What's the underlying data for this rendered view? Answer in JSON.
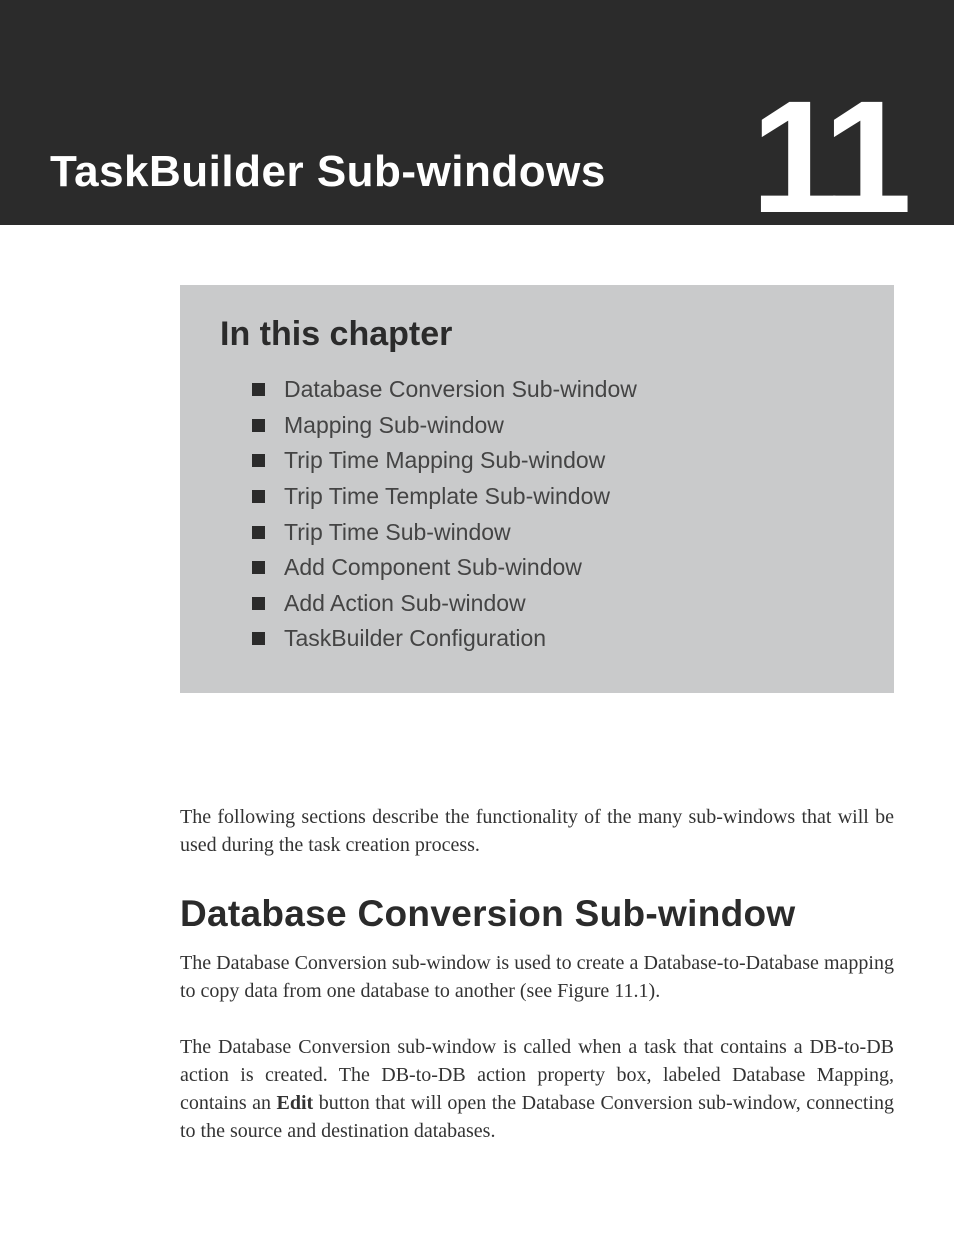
{
  "header": {
    "title": "TaskBuilder Sub-windows",
    "chapter_number": "11"
  },
  "in_chapter": {
    "heading": "In this chapter",
    "items": [
      "Database Conversion Sub-window",
      "Mapping Sub-window",
      "Trip Time Mapping Sub-window",
      "Trip Time Template Sub-window",
      "Trip Time Sub-window",
      "Add Component Sub-window",
      "Add Action Sub-window",
      "TaskBuilder Configuration"
    ]
  },
  "body": {
    "intro": "The following sections describe the functionality of the many sub-windows that will be used during the task creation process.",
    "section_heading": "Database Conversion Sub-window",
    "para1": "The Database Conversion sub-window is used to create a Database-to-Database mapping to copy data from one database to another (see Figure 11.1).",
    "para2_prefix": "The Database Conversion sub-window is called when a task that contains a DB-to-DB action is created. The DB-to-DB action property box, labeled Database Mapping, contains an ",
    "para2_bold": "Edit",
    "para2_suffix": " button that will open the Database Conversion sub-window, connecting to the source and destination databases."
  }
}
